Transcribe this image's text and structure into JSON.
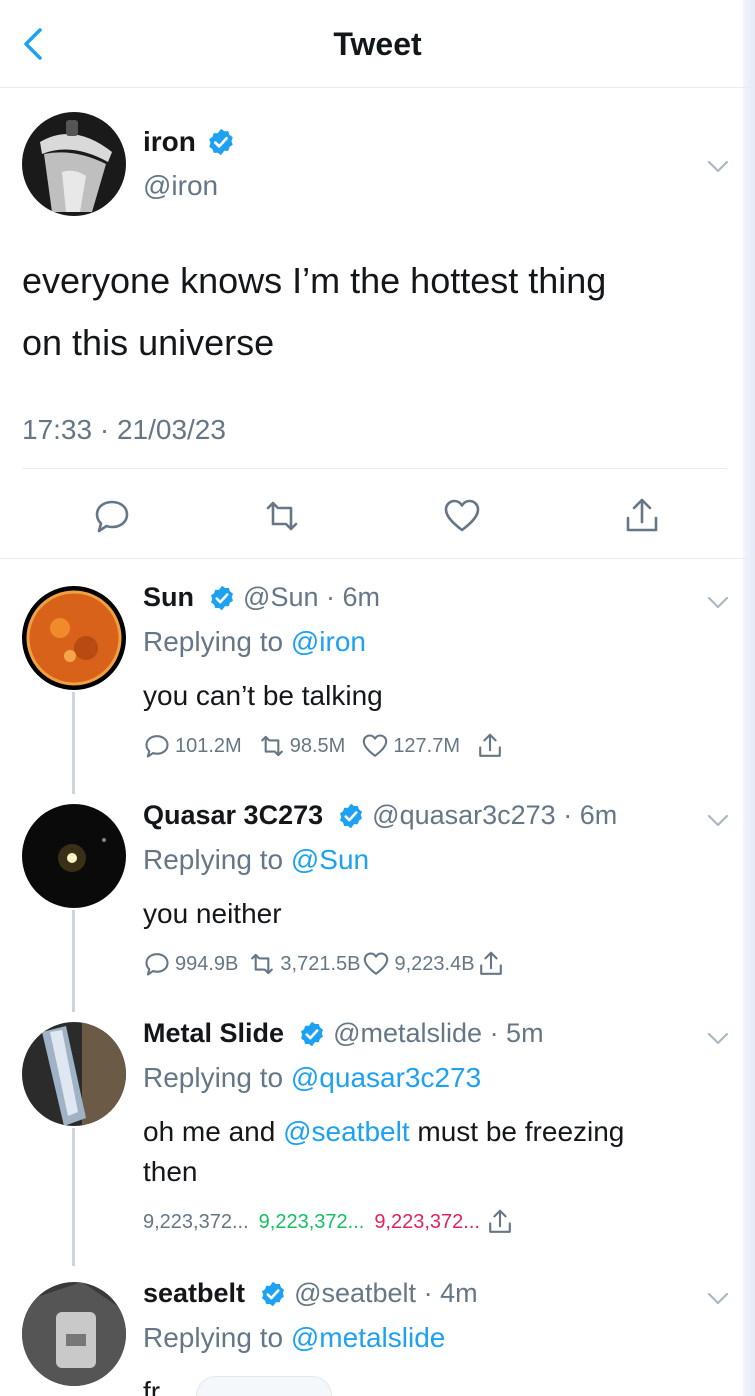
{
  "header": {
    "title": "Tweet"
  },
  "main_tweet": {
    "name": "iron",
    "handle": "@iron",
    "text_line1": "everyone knows I’m the hottest thing",
    "text_line2": "on this universe",
    "timestamp": "17:33 · 21/03/23"
  },
  "replies": [
    {
      "name": "Sun",
      "handle": "@Sun",
      "time": "· 6m",
      "replying_prefix": "Replying to",
      "replying_to": "@iron",
      "text": "you can’t be talking",
      "replies": "101.2M",
      "retweets": "98.5M",
      "likes": "127.7M"
    },
    {
      "name": "Quasar 3C273",
      "handle": "@quasar3c273",
      "time": "· 6m",
      "replying_prefix": "Replying to",
      "replying_to": "@Sun",
      "text": "you neither",
      "replies": "994.9B",
      "retweets": "3,721.5B",
      "likes": "9,223.4B"
    },
    {
      "name": "Metal Slide",
      "handle": "@metalslide",
      "time": "· 5m",
      "replying_prefix": "Replying to",
      "replying_to": "@quasar3c273",
      "text_before": "oh me and",
      "text_mention": "@seatbelt",
      "text_after": "must be freezing",
      "text_line2": "then",
      "replies": "9,223,372...",
      "retweets": "9,223,372...",
      "likes": "9,223,372..."
    },
    {
      "name": "seatbelt",
      "handle": "@seatbelt",
      "time": "· 4m",
      "replying_prefix": "Replying to",
      "replying_to": "@metalslide",
      "text": "fr"
    }
  ],
  "colors": {
    "accent": "#1da1f2",
    "retweet_green": "#17bf63",
    "like_red": "#e0245e",
    "secondary": "#657786"
  },
  "icons": [
    "back-chevron-icon",
    "verified-badge-icon",
    "chevron-down-icon",
    "reply-icon",
    "retweet-icon",
    "like-icon",
    "share-icon"
  ]
}
